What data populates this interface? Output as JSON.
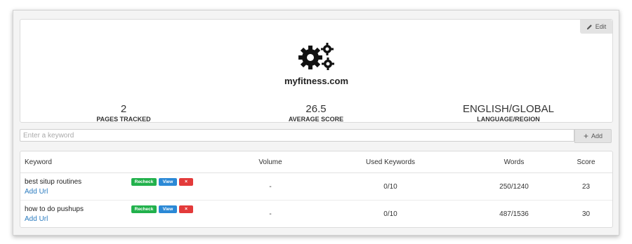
{
  "site": {
    "domain": "myfitness.com",
    "edit_label": "Edit",
    "logo_icon": "gears-icon"
  },
  "stats": [
    {
      "value": "2",
      "label": "PAGES TRACKED"
    },
    {
      "value": "26.5",
      "label": "AVERAGE SCORE"
    },
    {
      "value": "ENGLISH/GLOBAL",
      "label": "LANGUAGE/REGION"
    }
  ],
  "keyword_input": {
    "placeholder": "Enter a keyword",
    "add_label": "Add"
  },
  "table": {
    "headers": {
      "keyword": "Keyword",
      "volume": "Volume",
      "used_keywords": "Used Keywords",
      "words": "Words",
      "score": "Score"
    },
    "row_buttons": {
      "recheck": "Recheck",
      "view": "View",
      "delete": "×"
    },
    "rows": [
      {
        "keyword": "best situp routines",
        "add_url": "Add Url",
        "volume": "-",
        "used_keywords": "0/10",
        "words": "250/1240",
        "score": "23"
      },
      {
        "keyword": "how to do pushups",
        "add_url": "Add Url",
        "volume": "-",
        "used_keywords": "0/10",
        "words": "487/1536",
        "score": "30"
      }
    ]
  },
  "colors": {
    "recheck": "#22b14c",
    "view": "#2b89d6",
    "delete": "#e33a3a",
    "link": "#2a7bbf"
  }
}
